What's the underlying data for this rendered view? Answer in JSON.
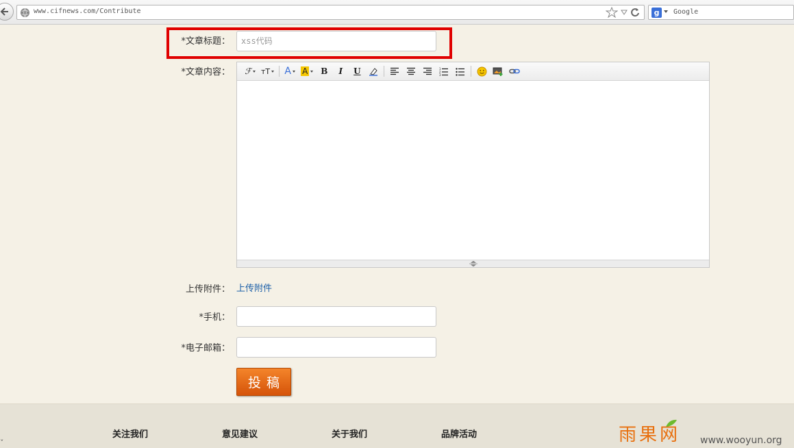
{
  "browser": {
    "url": "www.cifnews.com/Contribute",
    "search_engine": "Google"
  },
  "form": {
    "title_label": "*文章标题：",
    "title_value": "xss代码",
    "content_label": "*文章内容：",
    "toolbar": {
      "font_family": "ℱ",
      "font_size": "тT",
      "font_color": "A",
      "bg_color": "A",
      "bold": "B",
      "italic": "I",
      "underline": "U"
    },
    "attachment_label": "上传附件：",
    "attachment_link": "上传附件",
    "phone_label": "*手机：",
    "email_label": "*电子邮箱：",
    "submit_label": "投稿"
  },
  "footer": {
    "links": [
      "关注我们",
      "意见建议",
      "关于我们",
      "品牌活动"
    ],
    "logo_text": "雨果网"
  },
  "watermark": "www.wooyun.org",
  "colors": {
    "page_bg": "#f5f1e6",
    "highlight": "#e00000",
    "submit_bg": "#e8700f",
    "link": "#1c5fa8"
  }
}
